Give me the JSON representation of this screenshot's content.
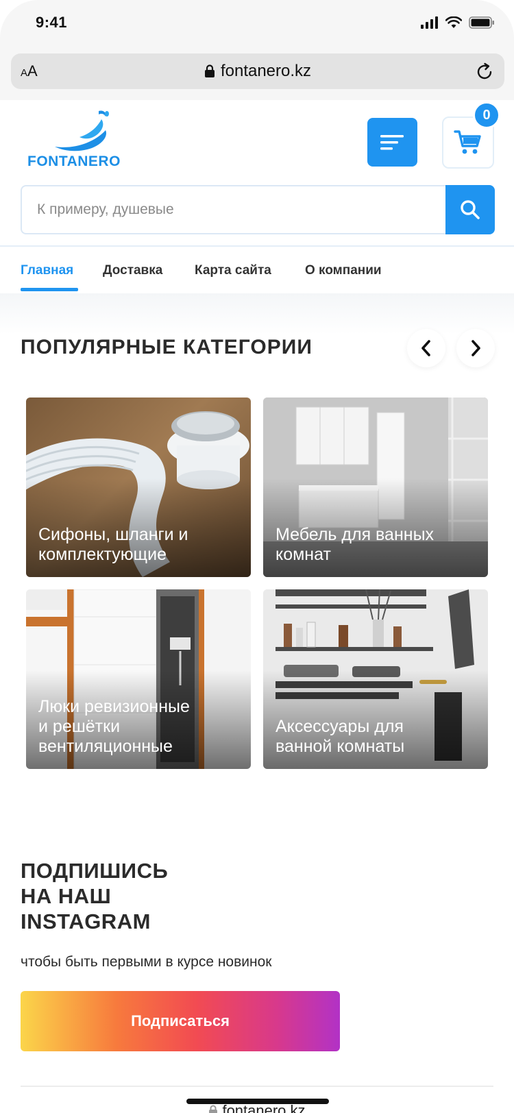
{
  "status_bar": {
    "time": "9:41"
  },
  "browser": {
    "text_size_label": "AA",
    "url": "fontanero.kz"
  },
  "header": {
    "logo_text": "FONTANERO",
    "cart_count": "0",
    "search_placeholder": "К примеру, душевые"
  },
  "nav": {
    "items": [
      {
        "label": "Главная",
        "active": true
      },
      {
        "label": "Доставка"
      },
      {
        "label": "Карта сайта"
      },
      {
        "label": "О компании"
      }
    ]
  },
  "categories": {
    "title": "ПОПУЛЯРНЫЕ КАТЕГОРИИ",
    "items": [
      {
        "label": "Сифоны, шланги и\nкомплектующие"
      },
      {
        "label": "Мебель для ванных\nкомнат"
      },
      {
        "label": "Люки ревизионные\nи решётки\nвентиляционные"
      },
      {
        "label": "Аксессуары для\nванной комнаты"
      }
    ]
  },
  "instagram": {
    "title": "ПОДПИШИСЬ\nНА НАШ\nINSTAGRAM",
    "subtitle": "чтобы быть первыми в курсе новинок",
    "button_label": "Подписаться"
  },
  "colors": {
    "accent": "#1f94f0",
    "text": "#2b2b2b",
    "gradient": [
      "#fbd54a",
      "#f77a3d",
      "#f24b52",
      "#d8398b",
      "#b232c6"
    ]
  },
  "icons": [
    "signal-icon",
    "wifi-icon",
    "battery-icon",
    "lock-icon",
    "reload-icon",
    "menu-icon",
    "cart-icon",
    "search-icon",
    "chevron-left-icon",
    "chevron-right-icon"
  ]
}
